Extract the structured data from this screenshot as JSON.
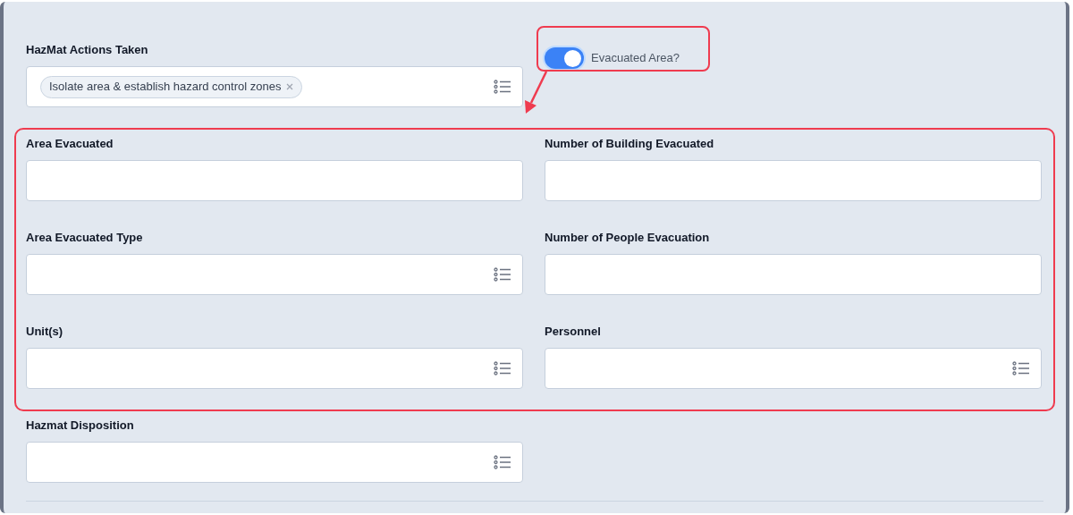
{
  "actions_field": {
    "label": "HazMat Actions Taken",
    "kind": "select",
    "chips": [
      "Isolate area & establish hazard control zones"
    ]
  },
  "evacuated_toggle": {
    "label": "Evacuated Area?",
    "on": true
  },
  "evacuation_fields": [
    {
      "label": "Area Evacuated",
      "kind": "text"
    },
    {
      "label": "Number of Building Evacuated",
      "kind": "text"
    },
    {
      "label": "Area Evacuated Type",
      "kind": "select"
    },
    {
      "label": "Number of People Evacuation",
      "kind": "text"
    },
    {
      "label": "Unit(s)",
      "kind": "select"
    },
    {
      "label": "Personnel",
      "kind": "select"
    }
  ],
  "disposition_field": {
    "label": "Hazmat Disposition",
    "kind": "select"
  }
}
